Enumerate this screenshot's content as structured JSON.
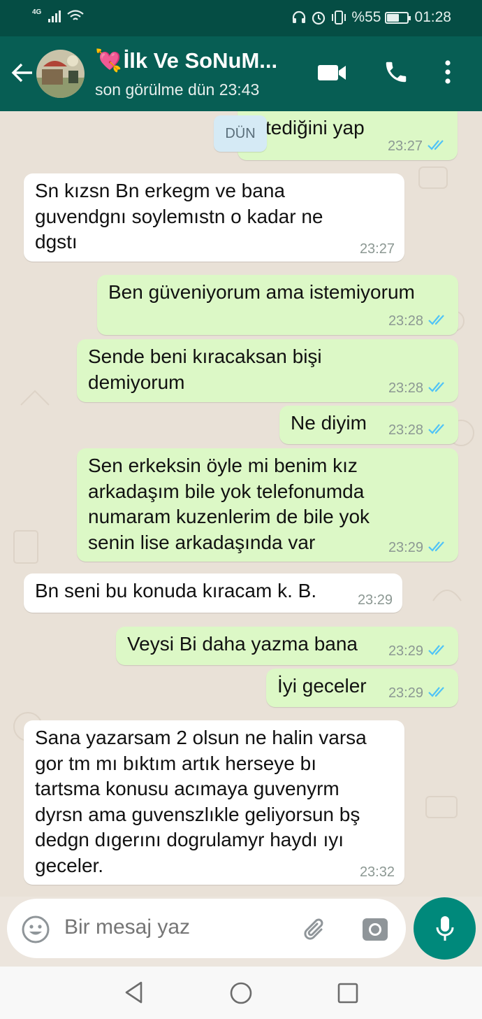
{
  "status_bar": {
    "network": "4G",
    "battery": "%55",
    "battery_level": 0.55,
    "time": "01:28"
  },
  "header": {
    "back_icon": "arrow-left-icon",
    "contact_name": "İlk Ve SoNuM...",
    "name_emoji": "💘",
    "last_seen": "son görülme dün 23:43",
    "actions": [
      "video-call-icon",
      "phone-icon",
      "more-vertical-icon"
    ]
  },
  "chat": {
    "date_chip": "DÜN",
    "messages": [
      {
        "direction": "out",
        "text": "tediğini yap",
        "time": "23:27",
        "read": true
      },
      {
        "direction": "in",
        "lines": [
          "Sn kızsn Bn erkegm ve bana",
          "guvendgnı soylemıstn o kadar ne",
          "dgstı"
        ],
        "time": "23:27"
      },
      {
        "direction": "out",
        "text": "Ben güveniyorum ama istemiyorum",
        "time": "23:28",
        "read": true
      },
      {
        "direction": "out",
        "lines": [
          "Sende beni kıracaksan bişi",
          "demiyorum"
        ],
        "time": "23:28",
        "read": true
      },
      {
        "direction": "out",
        "text": "Ne diyim",
        "time": "23:28",
        "read": true
      },
      {
        "direction": "out",
        "lines": [
          "Sen erkeksin öyle mi benim kız",
          "arkadaşım bile yok telefonumda",
          "numaram kuzenlerim de bile yok",
          "senin lise arkadaşında var"
        ],
        "time": "23:29",
        "read": true
      },
      {
        "direction": "in",
        "text": "Bn seni bu konuda kıracam k. B.",
        "time": "23:29"
      },
      {
        "direction": "out",
        "text": "Veysi Bi daha yazma bana",
        "time": "23:29",
        "read": true
      },
      {
        "direction": "out",
        "text": "İyi geceler",
        "time": "23:29",
        "read": true
      },
      {
        "direction": "in",
        "lines": [
          "Sana yazarsam 2 olsun ne halin varsa",
          "gor tm mı bıktım artık herseye bı",
          "tartsma konusu acımaya guvenyrm",
          "dyrsn ama guvenszlıkle geliyorsun bş",
          "dedgn dıgerını dogrulamyr haydı ıyı",
          "geceler."
        ],
        "time": "23:32"
      }
    ]
  },
  "composer": {
    "placeholder": "Bir mesaj yaz",
    "emoji_icon": "emoji-icon",
    "attach_icon": "paperclip-icon",
    "camera_icon": "camera-icon",
    "mic_icon": "microphone-icon"
  },
  "colors": {
    "header": "#075e54",
    "status_bar": "#054d44",
    "outgoing_bubble": "#dcf8c6",
    "incoming_bubble": "#ffffff",
    "read_ticks": "#4fc3f7",
    "mic_button": "#00897b"
  }
}
